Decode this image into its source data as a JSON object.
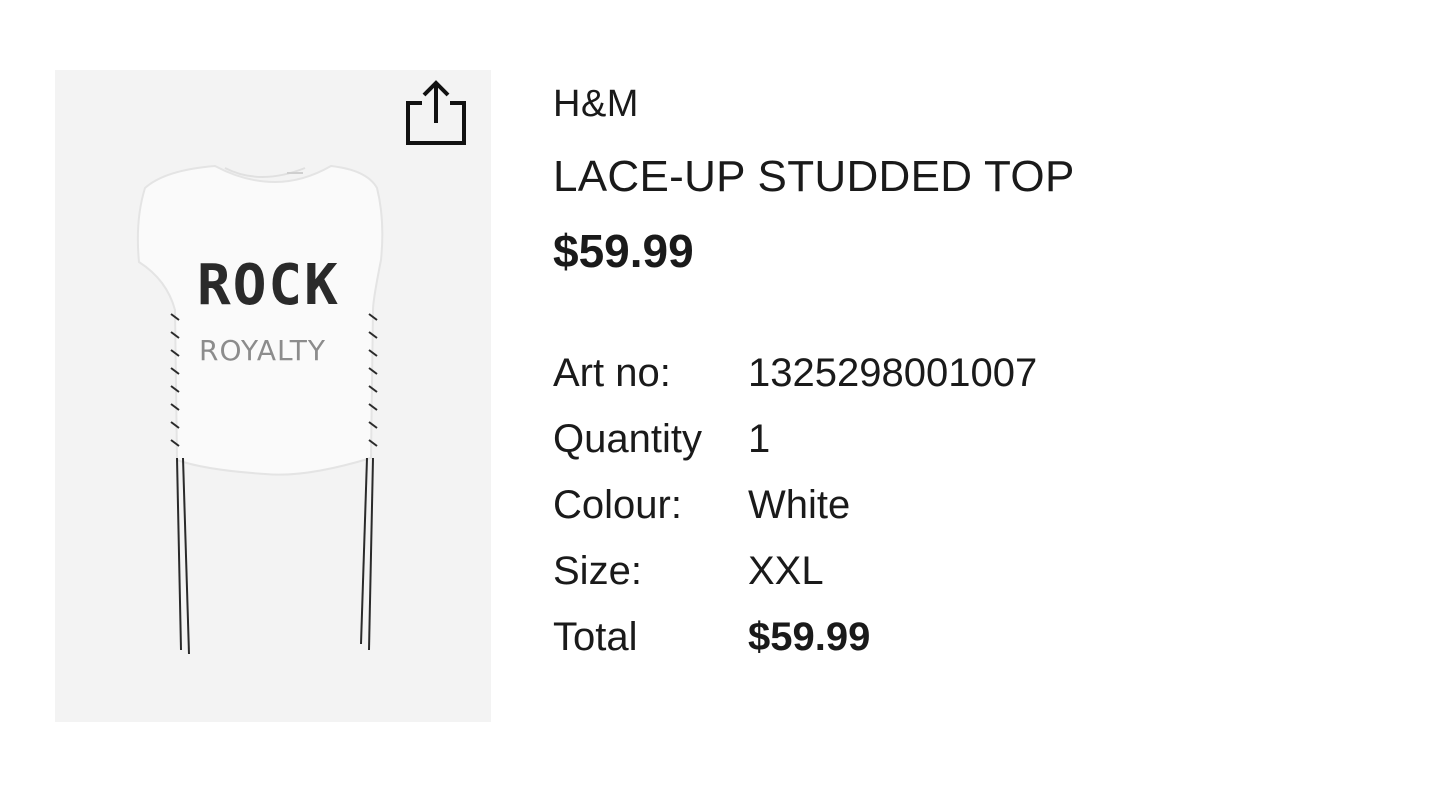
{
  "product": {
    "brand": "H&M",
    "name": "LACE-UP STUDDED TOP",
    "price": "$59.99",
    "image": {
      "graphic_text_line1": "ROCK",
      "graphic_text_line2": "ROYALTY"
    }
  },
  "share": {
    "icon": "share-icon"
  },
  "specs": [
    {
      "label": "Art no:",
      "value": "1325298001007"
    },
    {
      "label": "Quantity",
      "value": "1"
    },
    {
      "label": "Colour:",
      "value": "White"
    },
    {
      "label": "Size:",
      "value": "XXL"
    },
    {
      "label": "Total",
      "value": "$59.99"
    }
  ]
}
